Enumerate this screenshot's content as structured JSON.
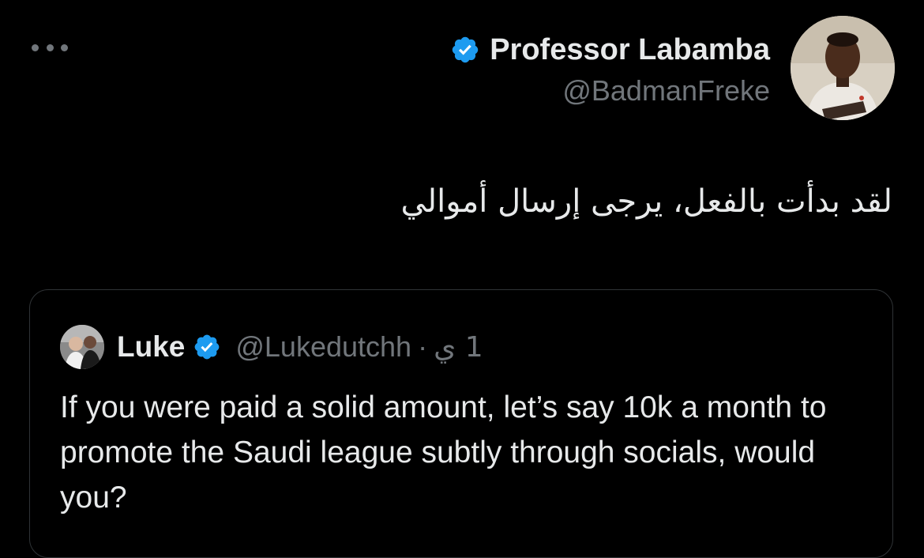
{
  "author": {
    "display_name": "Professor Labamba",
    "handle": "@BadmanFreke",
    "verified": true
  },
  "tweet": {
    "text": "لقد بدأت بالفعل، يرجى إرسال أموالي"
  },
  "quoted_tweet": {
    "display_name": "Luke",
    "handle": "@Lukedutchh",
    "separator": "·",
    "time": "1 ي",
    "verified": true,
    "text": "If you were paid a solid amount, let’s say 10k a month to promote the Saudi league subtly through socials, would you?"
  },
  "colors": {
    "background": "#000000",
    "text_primary": "#e7e9ea",
    "text_secondary": "#71767b",
    "verified_blue": "#1d9bf0",
    "border": "#2f3336"
  },
  "icons": {
    "more": "more-horizontal-icon",
    "verified": "verified-badge-icon"
  }
}
